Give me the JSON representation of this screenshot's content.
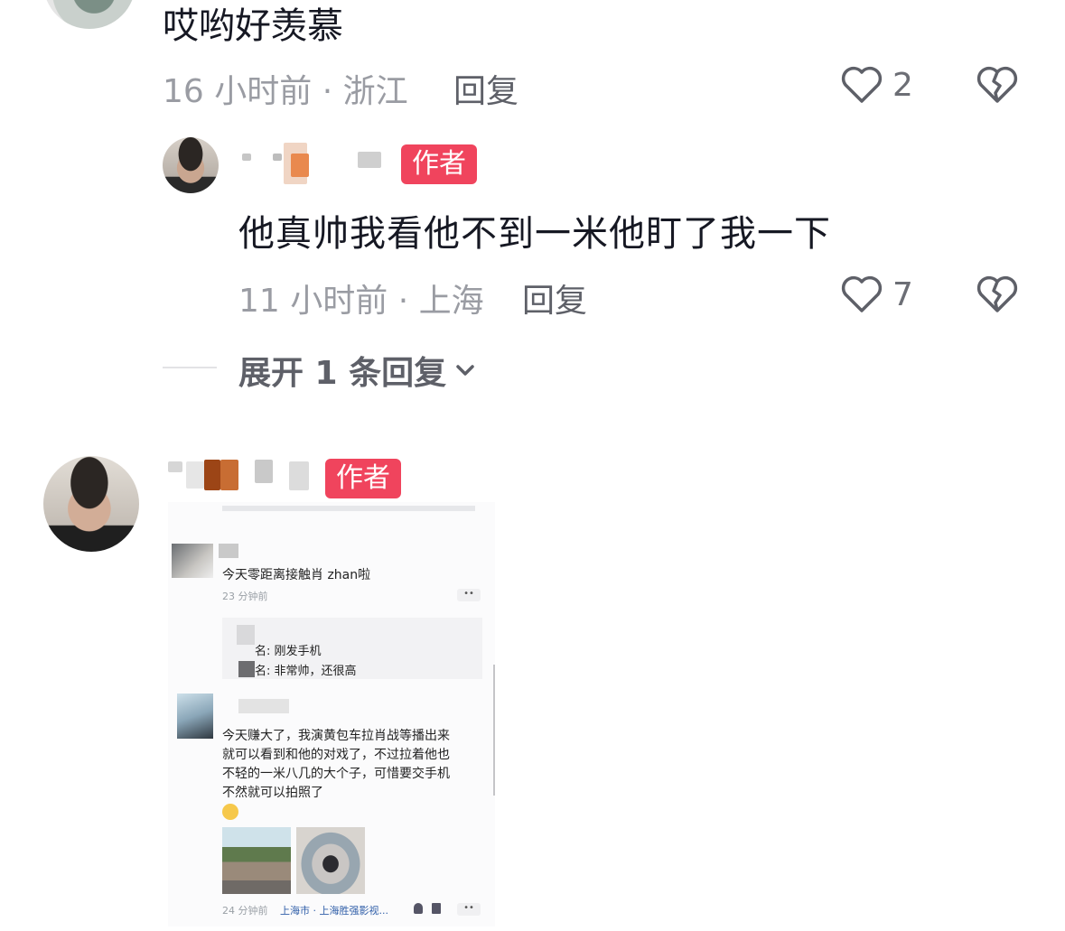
{
  "comments": [
    {
      "text": "哎哟好羡慕",
      "time": "16 小时前",
      "sep": "·",
      "location": "浙江",
      "reply_label": "回复",
      "likes": "2"
    },
    {
      "badge": "作者",
      "text": "他真帅我看他不到一米他盯了我一下",
      "time": "11 小时前",
      "sep": "·",
      "location": "上海",
      "reply_label": "回复",
      "likes": "7"
    }
  ],
  "expand": {
    "label": "展开 1 条回复"
  },
  "author_post": {
    "badge": "作者"
  },
  "screenshot": {
    "c1_text": "今天零距离接触肖 zhan啦",
    "c1_time": "23 分钟前",
    "q1": "名: 刚发手机",
    "q2": "名: 非常帅，还很高",
    "c2_lines": [
      "今天赚大了，我演黄包车拉肖战等播出来",
      "就可以看到和他的对戏了，不过拉着他也",
      "不轻的一米八几的大个子，可惜要交手机",
      "不然就可以拍照了"
    ],
    "c2_time": "24 分钟前",
    "c2_loc": "上海市 · 上海胜强影视..."
  },
  "colors": {
    "badge": "#f0445d",
    "meta": "#9a9ca3",
    "text": "#161823"
  }
}
